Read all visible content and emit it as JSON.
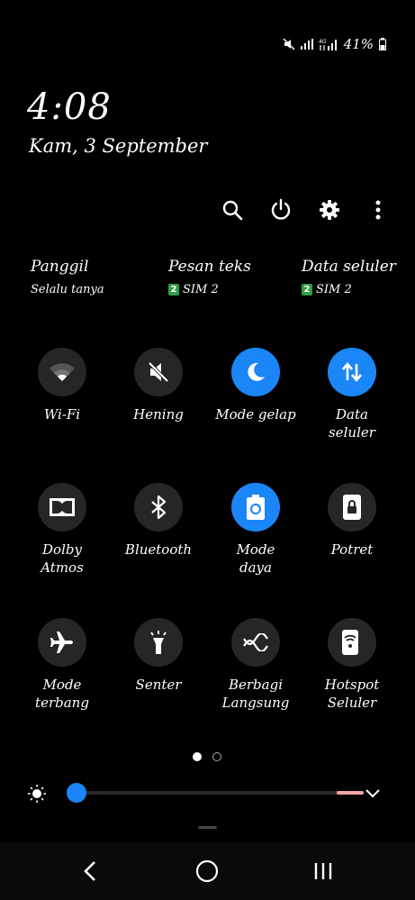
{
  "status": {
    "battery": "41%"
  },
  "clock": {
    "time": "4:08",
    "date": "Kam, 3 September"
  },
  "actions": [
    "search-icon",
    "power-icon",
    "gear-icon",
    "more-vertical-icon"
  ],
  "sim": [
    {
      "title": "Panggil",
      "sub": "Selalu tanya",
      "badge": ""
    },
    {
      "title": "Pesan teks",
      "sub": "SIM 2",
      "badge": "2"
    },
    {
      "title": "Data seluler",
      "sub": "SIM 2",
      "badge": "2"
    }
  ],
  "tiles": [
    {
      "label": "Wi-Fi",
      "icon": "wifi-icon",
      "on": false
    },
    {
      "label": "Hening",
      "icon": "mute-icon",
      "on": false
    },
    {
      "label": "Mode gelap",
      "icon": "moon-icon",
      "on": true
    },
    {
      "label": "Data\nseluler",
      "icon": "data-arrows-icon",
      "on": true
    },
    {
      "label": "Dolby\nAtmos",
      "icon": "dolby-icon",
      "on": false
    },
    {
      "label": "Bluetooth",
      "icon": "bluetooth-icon",
      "on": false
    },
    {
      "label": "Mode\ndaya",
      "icon": "battery-recycle-icon",
      "on": true
    },
    {
      "label": "Potret",
      "icon": "portrait-lock-icon",
      "on": false
    },
    {
      "label": "Mode\nterbang",
      "icon": "airplane-icon",
      "on": false
    },
    {
      "label": "Senter",
      "icon": "flashlight-icon",
      "on": false
    },
    {
      "label": "Berbagi\nLangsung",
      "icon": "share-icon",
      "on": false
    },
    {
      "label": "Hotspot\nSeluler",
      "icon": "hotspot-icon",
      "on": false
    }
  ],
  "pager": {
    "pages": 2,
    "current": 1
  },
  "brightness": {
    "level": 0.03
  },
  "nav": [
    "back-icon",
    "home-icon",
    "recents-icon"
  ]
}
